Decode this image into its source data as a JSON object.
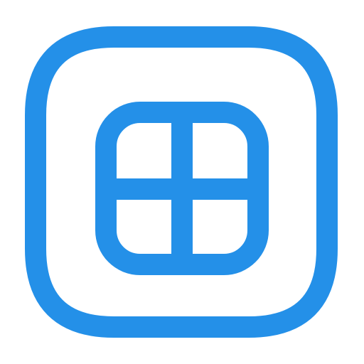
{
  "icon": {
    "name": "window-grid-icon",
    "stroke_color": "#2490E8",
    "background_color": "#FFFFFF"
  }
}
